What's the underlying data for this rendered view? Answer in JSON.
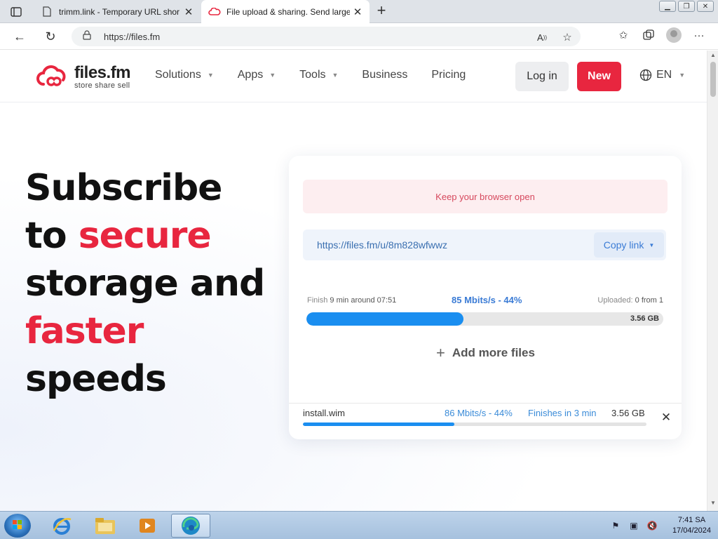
{
  "browser": {
    "tabs": [
      {
        "title": "trimm.link - Temporary URL shor",
        "active": false
      },
      {
        "title": "File upload & sharing. Send large",
        "active": true
      }
    ],
    "address": "https://files.fm",
    "window_controls": [
      "minimize",
      "restore",
      "close"
    ]
  },
  "site": {
    "logo": {
      "name": "files.fm",
      "tagline": "store  share  sell"
    },
    "nav": [
      {
        "label": "Solutions",
        "dropdown": true
      },
      {
        "label": "Apps",
        "dropdown": true
      },
      {
        "label": "Tools",
        "dropdown": true
      },
      {
        "label": "Business",
        "dropdown": false
      },
      {
        "label": "Pricing",
        "dropdown": false
      }
    ],
    "login_label": "Log in",
    "new_label": "New",
    "language": "EN",
    "colors": {
      "brand_red": "#e8263f",
      "progress_blue": "#1a8ef0",
      "link_blue": "#3a7bd5"
    }
  },
  "hero": {
    "line1": "Subscribe",
    "line2_a": "to ",
    "line2_b": "secure",
    "line3": "storage and",
    "line4": "faster",
    "line5": "speeds"
  },
  "upload": {
    "notice": "Keep your browser open",
    "share_url": "https://files.fm/u/8m828wfwwz",
    "copy_label": "Copy link",
    "finish_label": "Finish",
    "finish_value": "9 min around 07:51",
    "speed_summary": "85 Mbits/s - 44%",
    "uploaded_label": "Uploaded:",
    "uploaded_value": "0 from 1",
    "total_size": "3.56 GB",
    "progress_percent": 44,
    "add_more_label": "Add more files",
    "file": {
      "name": "install.wim",
      "speed": "86 Mbits/s - 44%",
      "finishes": "Finishes in 3 min",
      "size": "3.56 GB",
      "progress_percent": 44
    }
  },
  "taskbar": {
    "apps": [
      "internet-explorer-icon",
      "file-explorer-icon",
      "media-player-icon",
      "edge-icon"
    ],
    "time": "7:41 SA",
    "date": "17/04/2024"
  }
}
